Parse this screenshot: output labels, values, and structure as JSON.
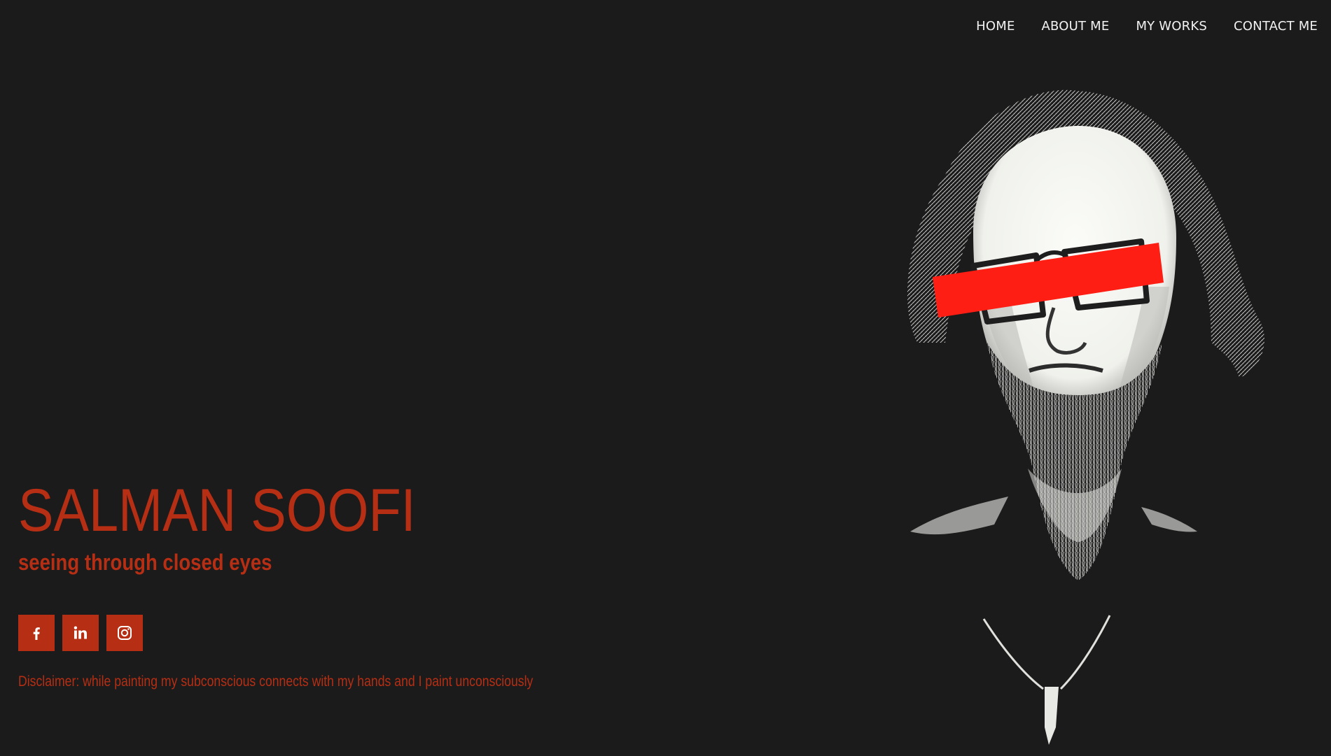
{
  "nav": {
    "items": [
      {
        "label": "HOME"
      },
      {
        "label": "ABOUT ME"
      },
      {
        "label": "MY WORKS"
      },
      {
        "label": "CONTACT ME"
      }
    ]
  },
  "hero": {
    "title": "SALMAN SOOFI",
    "subtitle": "seeing through closed eyes",
    "disclaimer": "Disclaimer: while painting my subconscious connects with my hands and I paint unconsciously"
  },
  "social": {
    "buttons": [
      {
        "icon": "facebook-icon"
      },
      {
        "icon": "linkedin-icon"
      },
      {
        "icon": "instagram-icon"
      }
    ]
  },
  "colors": {
    "background": "#1b1b1b",
    "accent": "#b62e14",
    "nav_text": "#f2f2f2",
    "eye_bar": "#ff1e14"
  }
}
